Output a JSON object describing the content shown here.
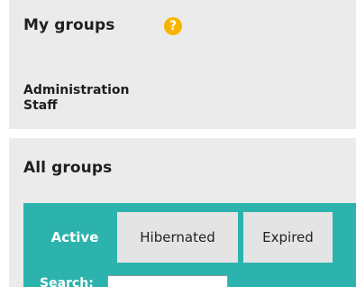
{
  "my_groups": {
    "title": "My groups",
    "help_icon_glyph": "?",
    "help_icon_color": "#f7b500",
    "groups": [
      "Administration",
      "Staff"
    ]
  },
  "all_groups": {
    "title": "All groups",
    "tabs": [
      {
        "label": "Active",
        "selected": true
      },
      {
        "label": "Hibernated",
        "selected": false
      },
      {
        "label": "Expired",
        "selected": false
      }
    ],
    "search_label": "Search:",
    "search_value": "",
    "accent_color": "#2db3ad"
  }
}
